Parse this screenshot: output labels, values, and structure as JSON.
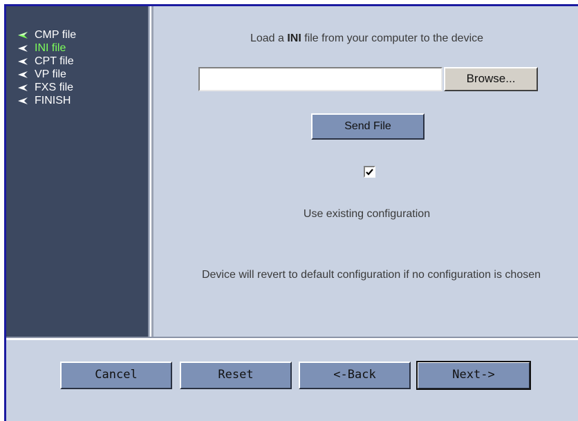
{
  "sidebar": {
    "items": [
      {
        "label": "CMP file",
        "state": "done"
      },
      {
        "label": "INI file",
        "state": "active"
      },
      {
        "label": "CPT file",
        "state": "pending"
      },
      {
        "label": "VP file",
        "state": "pending"
      },
      {
        "label": "FXS file",
        "state": "pending"
      },
      {
        "label": "FINISH",
        "state": "pending"
      }
    ]
  },
  "main": {
    "heading_pre": "Load a",
    "heading_bold": "INI",
    "heading_post": "file from your computer to the device",
    "file_input_value": "",
    "browse_label": "Browse...",
    "send_label": "Send File",
    "use_existing_checked": true,
    "use_existing_label": "Use existing configuration",
    "warning": "Device will revert to default configuration if no configuration is chosen"
  },
  "footer": {
    "cancel_label": "Cancel",
    "reset_label": "Reset",
    "back_label": "<-Back",
    "next_label": "Next->"
  },
  "colors": {
    "sidebar_bg": "#3c4860",
    "content_bg": "#c9d2e2",
    "button_bg": "#7d91b6",
    "active_item": "#7dff5a",
    "frame_border": "#1a1aa0"
  }
}
